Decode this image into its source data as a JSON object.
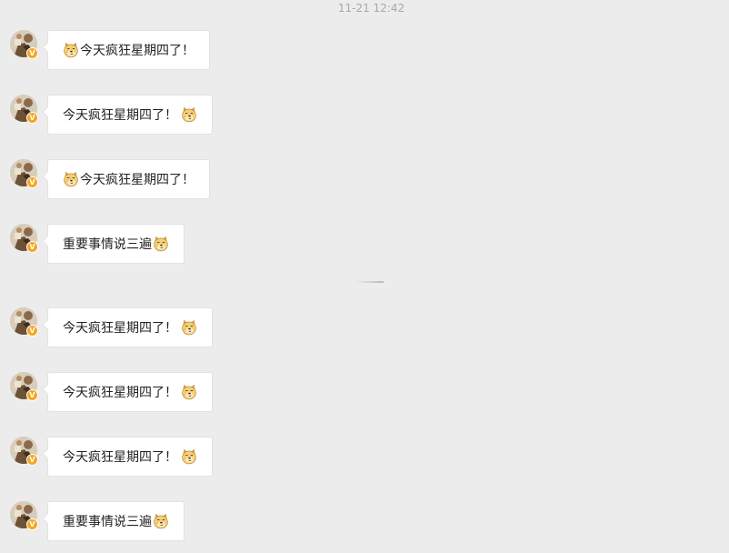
{
  "timestamp": "11-21 12:42",
  "colors": {
    "background": "#ececec",
    "bubble": "#ffffff",
    "text": "#222222",
    "timestamp": "#a8a8a8",
    "badge": "#f5a623"
  },
  "badge_letter": "V",
  "messages": [
    {
      "text": "今天疯狂星期四了！",
      "emoji": "doge-icon",
      "emoji_position": "before"
    },
    {
      "text": "今天疯狂星期四了！",
      "emoji": "doge-icon",
      "emoji_position": "after"
    },
    {
      "text": "今天疯狂星期四了！",
      "emoji": "doge-icon",
      "emoji_position": "before"
    },
    {
      "text": "重要事情说三遍",
      "emoji": "doge-icon",
      "emoji_position": "after"
    },
    {
      "text": "今天疯狂星期四了！",
      "emoji": "doge-icon",
      "emoji_position": "after"
    },
    {
      "text": "今天疯狂星期四了！",
      "emoji": "doge-icon",
      "emoji_position": "after"
    },
    {
      "text": "今天疯狂星期四了！",
      "emoji": "doge-icon",
      "emoji_position": "after"
    },
    {
      "text": "重要事情说三遍",
      "emoji": "doge-icon",
      "emoji_position": "after"
    }
  ]
}
